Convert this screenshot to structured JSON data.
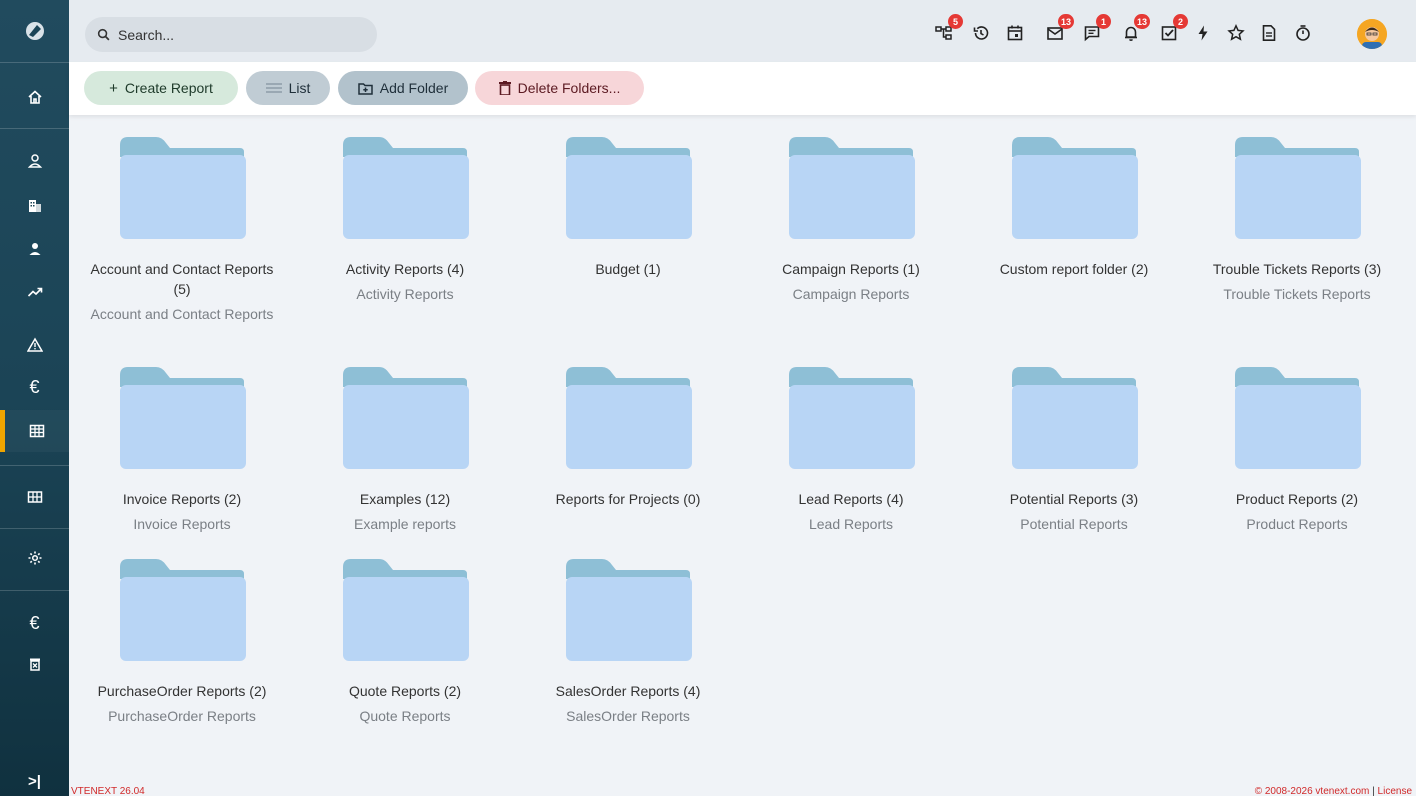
{
  "search": {
    "placeholder": "Search..."
  },
  "header": {
    "badges": {
      "hierarchy": "5",
      "mail": "13",
      "messages": "1",
      "notifications": "13",
      "tasks": "2"
    }
  },
  "toolbar": {
    "create_label": "Create Report",
    "list_label": "List",
    "add_folder_label": "Add Folder",
    "delete_folders_label": "Delete Folders..."
  },
  "folders": [
    {
      "title": "Account and Contact Reports (5)",
      "desc": "Account and Contact Reports"
    },
    {
      "title": "Activity Reports (4)",
      "desc": "Activity Reports"
    },
    {
      "title": "Budget (1)",
      "desc": ""
    },
    {
      "title": "Campaign Reports (1)",
      "desc": "Campaign Reports"
    },
    {
      "title": "Custom report folder (2)",
      "desc": ""
    },
    {
      "title": "Trouble Tickets Reports (3)",
      "desc": "Trouble Tickets Reports"
    },
    {
      "title": "Invoice Reports (2)",
      "desc": "Invoice Reports"
    },
    {
      "title": "Examples (12)",
      "desc": "Example reports"
    },
    {
      "title": "Reports for Projects (0)",
      "desc": ""
    },
    {
      "title": "Lead Reports (4)",
      "desc": "Lead Reports"
    },
    {
      "title": "Potential Reports (3)",
      "desc": "Potential Reports"
    },
    {
      "title": "Product Reports (2)",
      "desc": "Product Reports"
    },
    {
      "title": "PurchaseOrder Reports (2)",
      "desc": "PurchaseOrder Reports"
    },
    {
      "title": "Quote Reports (2)",
      "desc": "Quote Reports"
    },
    {
      "title": "SalesOrder Reports (4)",
      "desc": "SalesOrder Reports"
    }
  ],
  "footer": {
    "version": "VTENEXT 26.04",
    "copyright": "© 2008-2026 vtenext.com",
    "separator": "|",
    "license": "License"
  },
  "colors": {
    "accent": "#f0a500",
    "folder_body": "#b8d5f5",
    "folder_tab": "#8ebfd6",
    "badge": "#e53935"
  }
}
